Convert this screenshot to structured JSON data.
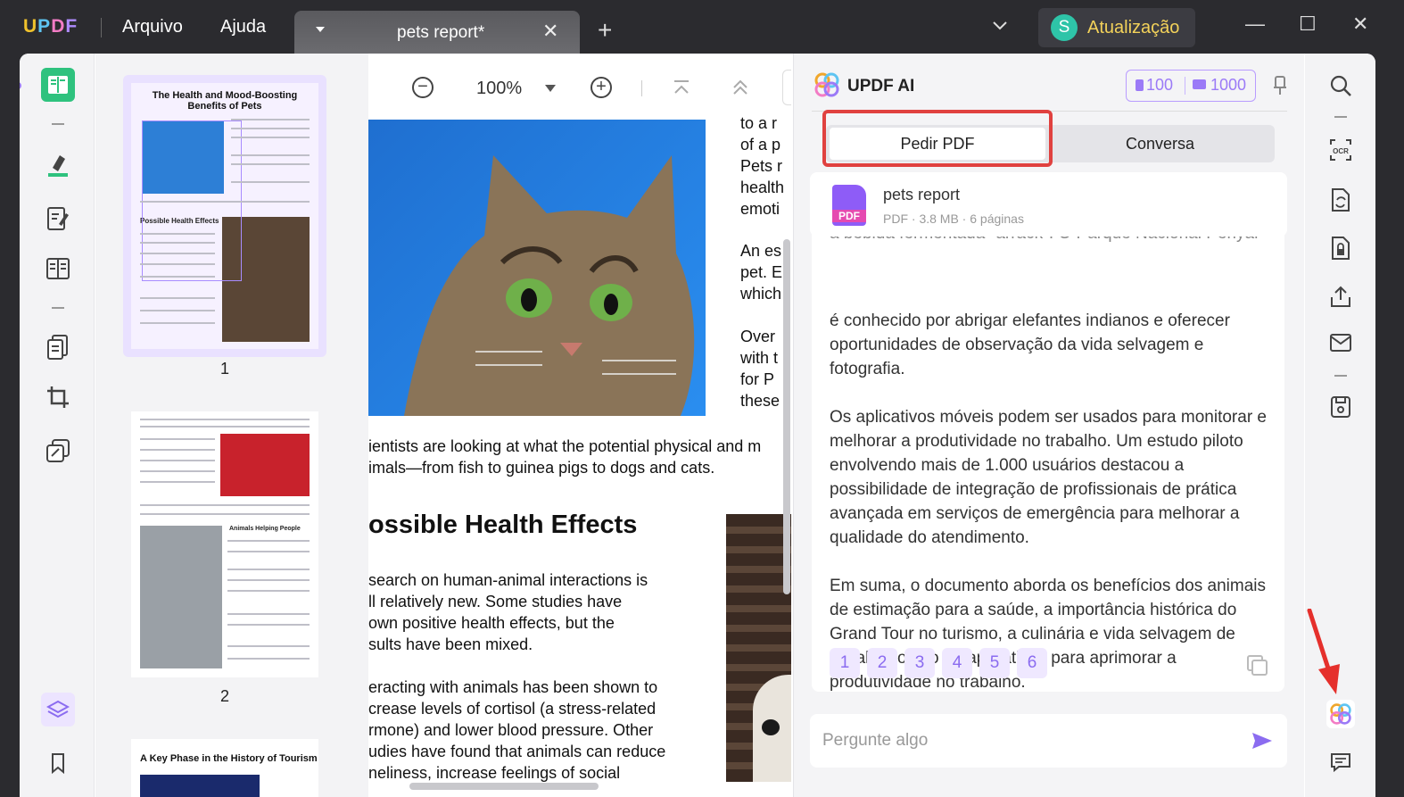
{
  "app": {
    "logo": {
      "u": "U",
      "p": "P",
      "d": "D",
      "f": "F"
    },
    "menu": {
      "file": "Arquivo",
      "help": "Ajuda"
    },
    "tab": {
      "title": "pets report*",
      "close": "✕"
    },
    "tab_add": "+",
    "chevron": "⌄",
    "upgrade": {
      "avatar": "S",
      "label": "Atualização"
    },
    "window": {
      "minimize": "—",
      "maximize": "☐",
      "close": "✕"
    }
  },
  "thumbnails": {
    "page1": {
      "title": "The Health and Mood-Boosting Benefits of Pets",
      "section": "Possible Health Effects",
      "number": "1"
    },
    "page2": {
      "section": "Animals Helping People",
      "number": "2"
    },
    "page3": {
      "title": "A Key Phase in the History of Tourism"
    }
  },
  "viewer": {
    "zoom": "100%",
    "right_col": [
      "to a r",
      "of a p",
      "Pets r",
      "health",
      "emoti",
      "An es",
      "pet. E",
      "which",
      "Over",
      "with t",
      "for P",
      "these"
    ],
    "caption1": "ientists are looking at what the potential physical and m",
    "caption2": "imals—from fish to guinea pigs to dogs and cats.",
    "heading": "ossible Health Effects",
    "para1": [
      "search on human-animal interactions is",
      "ll relatively new. Some studies have",
      "own positive health effects, but the",
      "sults have been mixed."
    ],
    "para2": [
      "eracting with animals has been shown to",
      "crease levels of cortisol (a stress-related",
      "rmone) and lower blood pressure. Other",
      "udies have found that animals can reduce",
      "neliness, increase feelings of social"
    ]
  },
  "ai": {
    "title": "UPDF AI",
    "credits": {
      "docs": "100",
      "chats": "1000"
    },
    "tabs": {
      "ask_pdf": "Pedir PDF",
      "chat": "Conversa"
    },
    "file": {
      "icon_label": "PDF",
      "name": "pets report",
      "meta": "PDF · 3.8 MB · 6 páginas"
    },
    "answer": {
      "p0": "a bebida fermentada \"arrack\". O Parque Nacional Periyar",
      "p1": "é conhecido por abrigar elefantes indianos e oferecer oportunidades de observação da vida selvagem e fotografia.",
      "p2": "Os aplicativos móveis podem ser usados para monitorar e melhorar a produtividade no trabalho. Um estudo piloto envolvendo mais de 1.000 usuários destacou a possibilidade de integração de profissionais de prática avançada em serviços de emergência para melhorar a qualidade do atendimento.",
      "p3": "Em suma, o documento aborda os benefícios dos animais de estimação para a saúde, a importância histórica do Grand Tour no turismo, a culinária e vida selvagem de Kerala e o uso de aplicativos para aprimorar a produtividade no trabalho."
    },
    "citations": [
      "1",
      "2",
      "3",
      "4",
      "5",
      "6"
    ],
    "input_placeholder": "Pergunte algo"
  },
  "colors": {
    "accent": "#8b6cf0",
    "highlight": "#e0413f",
    "upgrade": "#f3d25a"
  }
}
